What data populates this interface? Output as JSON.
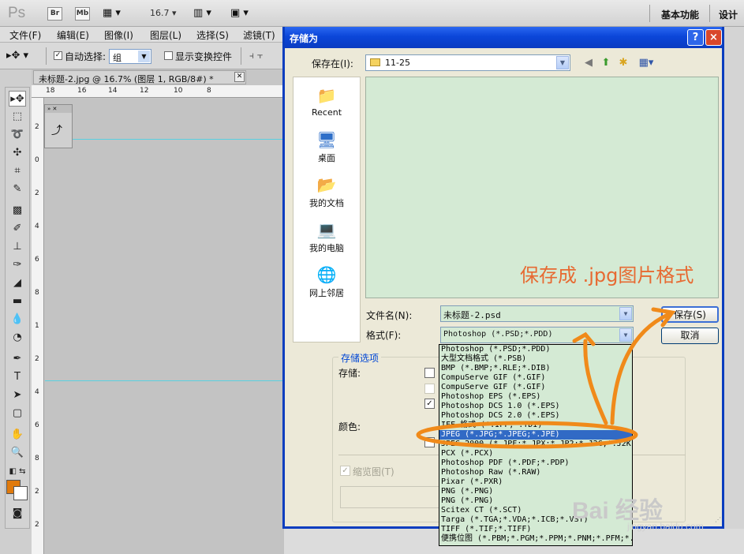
{
  "appbar": {
    "logo": "Ps",
    "bridge": "Br",
    "mini_bridge": "Mb",
    "zoom": "16.7",
    "workspace_basic": "基本功能",
    "workspace_design": "设计"
  },
  "menu": {
    "items": [
      "文件(F)",
      "编辑(E)",
      "图像(I)",
      "图层(L)",
      "选择(S)",
      "滤镜(T)"
    ]
  },
  "options": {
    "auto_select_label": "自动选择:",
    "auto_select_checked": true,
    "auto_select_value": "组",
    "show_transform_label": "显示变换控件"
  },
  "document": {
    "tab_title": "未标题-2.jpg @ 16.7% (图层 1, RGB/8#) *",
    "ruler_top": [
      "18",
      "16",
      "14",
      "12",
      "10",
      "8"
    ],
    "ruler_left": [
      "2",
      "0",
      "2",
      "4",
      "6",
      "8",
      "1",
      "2",
      "4",
      "6",
      "8",
      "2",
      "2",
      "4",
      "6",
      "8",
      "3",
      "3",
      "2",
      "4",
      "6",
      "8"
    ]
  },
  "dialog": {
    "title": "存储为",
    "help": "?",
    "close": "×",
    "save_in_label": "保存在(I):",
    "save_in_value": "11-25",
    "places": [
      "Recent",
      "桌面",
      "我的文档",
      "我的电脑",
      "网上邻居"
    ],
    "annotation": "保存成 .jpg图片格式",
    "filename_label": "文件名(N):",
    "filename_value": "未标题-2.psd",
    "format_label": "格式(F):",
    "format_value": "Photoshop (*.PSD;*.PDD)",
    "save_button": "保存(S)",
    "cancel_button": "取消",
    "options_legend": "存储选项",
    "store_label": "存储:",
    "color_label": "颜色:",
    "thumbnail_label": "缩览图(T)",
    "format_options": [
      "Photoshop (*.PSD;*.PDD)",
      "大型文档格式 (*.PSB)",
      "BMP (*.BMP;*.RLE;*.DIB)",
      "CompuServe GIF (*.GIF)",
      "CompuServe GIF (*.GIF)",
      "Photoshop EPS (*.EPS)",
      "Photoshop DCS 1.0 (*.EPS)",
      "Photoshop DCS 2.0 (*.EPS)",
      "IFF 格式 (*.IFF;*.TDI)",
      "JPEG (*.JPG;*.JPEG;*.JPE)",
      "JPEG 2000 (*.JPF;*.JPX;*.JP2;*.J2C;*.J2K)",
      "PCX (*.PCX)",
      "Photoshop PDF (*.PDF;*.PDP)",
      "Photoshop Raw (*.RAW)",
      "Pixar (*.PXR)",
      "PNG (*.PNG)",
      "PNG (*.PNG)",
      "Scitex CT (*.SCT)",
      "Targa (*.TGA;*.VDA;*.ICB;*.VST)",
      "TIFF (*.TIF;*.TIFF)",
      "便携位图 (*.PBM;*.PGM;*.PPM;*.PNM;*.PFM;*.PAM)"
    ],
    "selected_format": "JPEG (*.JPG;*.JPEG;*.JPE)"
  },
  "watermark": {
    "brand": "Bai 经验",
    "url": "jingyan.baidu.com"
  },
  "colors": {
    "annotation": "#e76a32",
    "titlebar": "#0b46d9",
    "selection": "#316ac5",
    "foreground_swatch": "#e07a0c"
  }
}
